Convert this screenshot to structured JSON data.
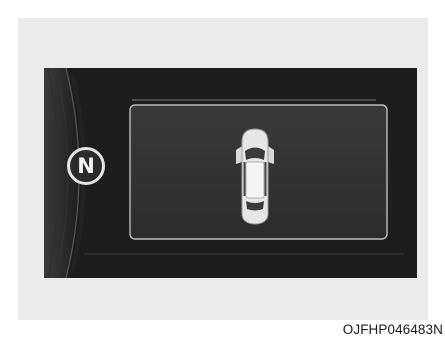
{
  "display": {
    "gear_indicator": "N",
    "vehicle_icon": "car-top-view-doors-open-icon"
  },
  "figure_code": "OJFHP046483N"
}
